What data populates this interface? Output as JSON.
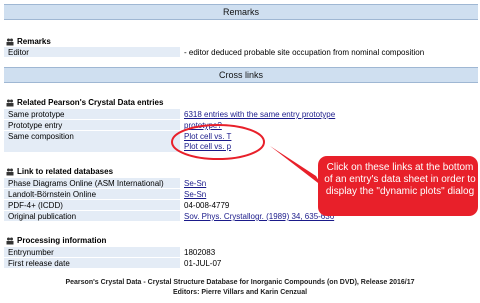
{
  "remarks_band": "Remarks",
  "remarks": {
    "title": "Remarks",
    "rows": [
      {
        "label": "Editor",
        "value": "- editor deduced probable site occupation from nominal composition"
      }
    ]
  },
  "crosslinks_band": "Cross links",
  "pearson": {
    "title": "Related Pearson's Crystal Data entries",
    "same_prototype_label": "Same prototype",
    "same_prototype_value": "6318 entries with the same entry prototype",
    "prototype_entry_label": "Prototype entry",
    "prototype_entry_value": "prototype?",
    "same_composition_label": "Same composition",
    "plot_link_1": "Plot cell vs. T",
    "plot_link_2": "Plot cell vs. p"
  },
  "databases": {
    "title": "Link to related databases",
    "rows": [
      {
        "label": "Phase Diagrams Online (ASM International)",
        "value": "Se-Sn"
      },
      {
        "label": "Landolt-Börnstein Online",
        "value": "Se-Sn"
      },
      {
        "label": "PDF-4+ (ICDD)",
        "value": "04-008-4779"
      },
      {
        "label": "Original publication",
        "value": "Sov. Phys. Crystallogr. (1989) 34, 635-636"
      }
    ]
  },
  "processing": {
    "title": "Processing information",
    "rows": [
      {
        "label": "Entrynumber",
        "value": "1802083"
      },
      {
        "label": "First release date",
        "value": "01-JUL-07"
      }
    ]
  },
  "footer": {
    "line1": "Pearson's Crystal Data - Crystal Structure Database for Inorganic Compounds (on DVD), Release 2016/17",
    "line2": "Editors: Pierre Villars and Karin Cenzual"
  },
  "callout": {
    "text": "Click on these links at the bottom of an entry's data sheet in order to display the \"dynamic plots\" dialog",
    "color": "#e8202a"
  },
  "colors": {
    "band": "#cfdff0",
    "label_bg": "#e4ecf6",
    "link": "#1a1a8a"
  }
}
